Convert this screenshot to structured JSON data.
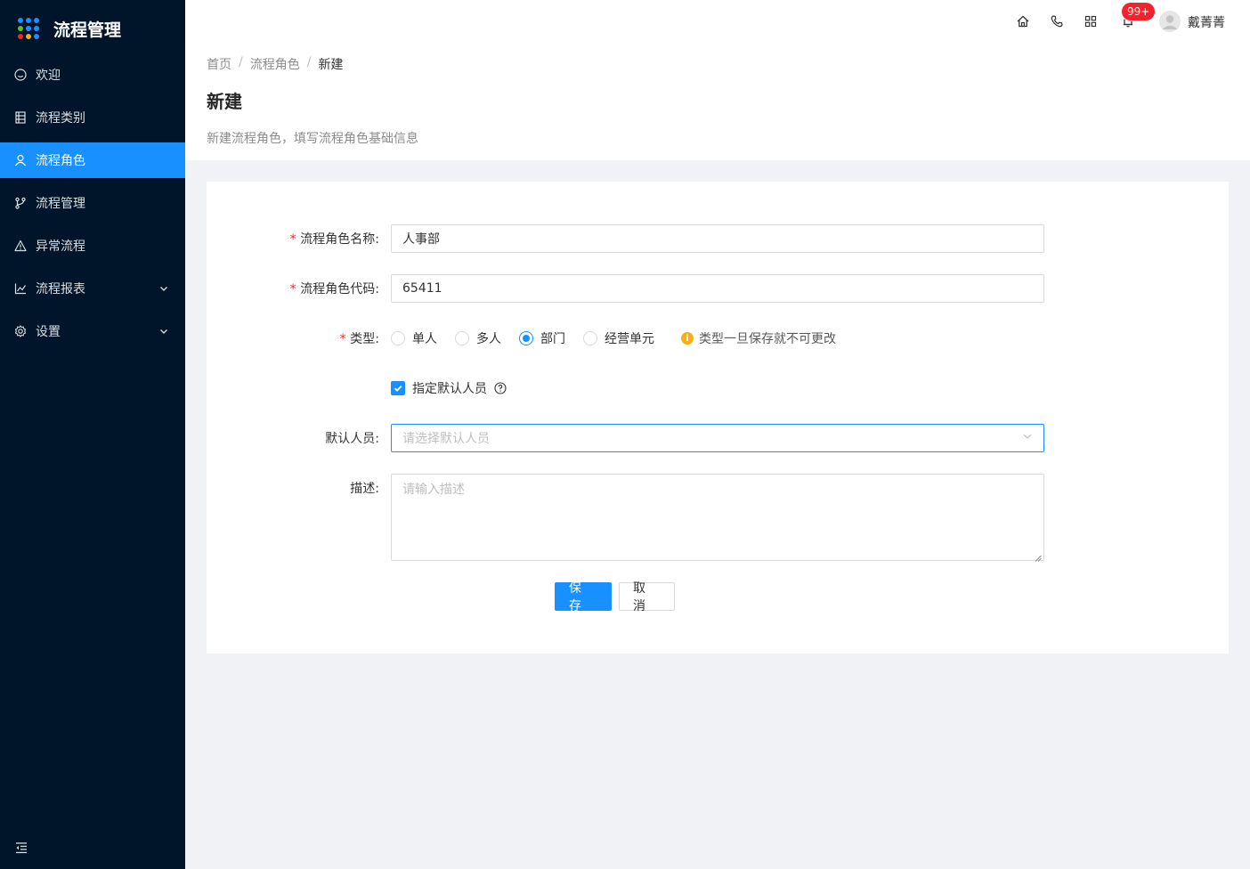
{
  "app": {
    "title": "流程管理",
    "logo_colors": [
      "#1890ff",
      "#1890ff",
      "#1890ff",
      "#52c41a",
      "#1890ff",
      "#1890ff",
      "#f5222d",
      "#faad14",
      "#1890ff"
    ]
  },
  "sidebar": {
    "items": [
      {
        "label": "欢迎",
        "icon": "smile-icon",
        "active": false,
        "has_arrow": false
      },
      {
        "label": "流程类别",
        "icon": "list-icon",
        "active": false,
        "has_arrow": false
      },
      {
        "label": "流程角色",
        "icon": "user-icon",
        "active": true,
        "has_arrow": false
      },
      {
        "label": "流程管理",
        "icon": "branch-icon",
        "active": false,
        "has_arrow": false
      },
      {
        "label": "异常流程",
        "icon": "warning-icon",
        "active": false,
        "has_arrow": false
      },
      {
        "label": "流程报表",
        "icon": "chart-icon",
        "active": false,
        "has_arrow": true
      },
      {
        "label": "设置",
        "icon": "gear-icon",
        "active": false,
        "has_arrow": true
      }
    ]
  },
  "header": {
    "notification_count": "99+",
    "username": "戴菁菁",
    "icons": [
      "home-icon",
      "phone-icon",
      "apps-icon",
      "bell-icon"
    ]
  },
  "page": {
    "breadcrumb": [
      "首页",
      "流程角色",
      "新建"
    ],
    "title": "新建",
    "description": "新建流程角色，填写流程角色基础信息"
  },
  "form": {
    "name_label": "流程角色名称:",
    "name_value": "人事部",
    "code_label": "流程角色代码:",
    "code_value": "65411",
    "type_label": "类型:",
    "type_options": [
      "单人",
      "多人",
      "部门",
      "经营单元"
    ],
    "type_selected": "部门",
    "type_hint": "类型一旦保存就不可更改",
    "default_checkbox_label": "指定默认人员",
    "default_checkbox_checked": true,
    "default_person_label": "默认人员:",
    "default_person_placeholder": "请选择默认人员",
    "desc_label": "描述:",
    "desc_placeholder": "请输入描述",
    "save_label": "保存",
    "cancel_label": "取消"
  }
}
